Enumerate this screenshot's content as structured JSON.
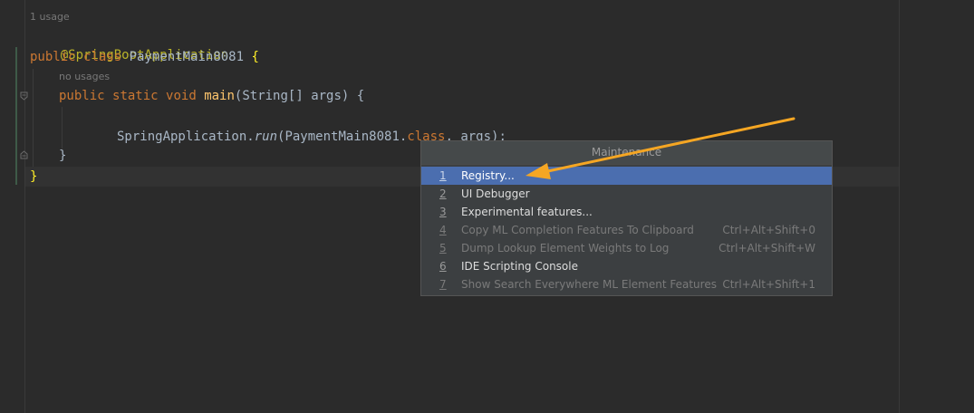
{
  "editor": {
    "usage_hint_class": "1 usage",
    "annotation": "@SpringBootApplication",
    "line_class": {
      "kw_public": "public",
      "kw_class": "class",
      "name": "PaymentMain8081",
      "brace": "{"
    },
    "usage_hint_method": "no usages",
    "line_main": {
      "kw_public": "public",
      "kw_static": "static",
      "kw_void": "void",
      "name": "main",
      "params": "(String[] args) {"
    },
    "line_run": {
      "receiver": "SpringApplication.",
      "method": "run",
      "open": "(PaymentMain8081.",
      "kw_class": "class",
      "rest": ", args);"
    },
    "close_method": "}",
    "close_class": "}"
  },
  "popup": {
    "title": "Maintenance",
    "items": [
      {
        "num": "1",
        "label": "Registry...",
        "shortcut": "",
        "state": "selected"
      },
      {
        "num": "2",
        "label": "UI Debugger",
        "shortcut": "",
        "state": "enabled"
      },
      {
        "num": "3",
        "label": "Experimental features...",
        "shortcut": "",
        "state": "enabled"
      },
      {
        "num": "4",
        "label": "Copy ML Completion Features To Clipboard",
        "shortcut": "Ctrl+Alt+Shift+0",
        "state": "disabled"
      },
      {
        "num": "5",
        "label": "Dump Lookup Element Weights to Log",
        "shortcut": "Ctrl+Alt+Shift+W",
        "state": "disabled"
      },
      {
        "num": "6",
        "label": "IDE Scripting Console",
        "shortcut": "",
        "state": "enabled"
      },
      {
        "num": "7",
        "label": "Show Search Everywhere ML Element Features",
        "shortcut": "Ctrl+Alt+Shift+1",
        "state": "disabled"
      }
    ]
  },
  "colors": {
    "editor_bg": "#2b2b2b",
    "keyword": "#cc7832",
    "annotation": "#bbb529",
    "method_decl": "#ffc66d",
    "selection": "#4b6eaf",
    "arrow": "#f5a623"
  },
  "icons": [
    "fold-icon",
    "arrow-annotation"
  ]
}
